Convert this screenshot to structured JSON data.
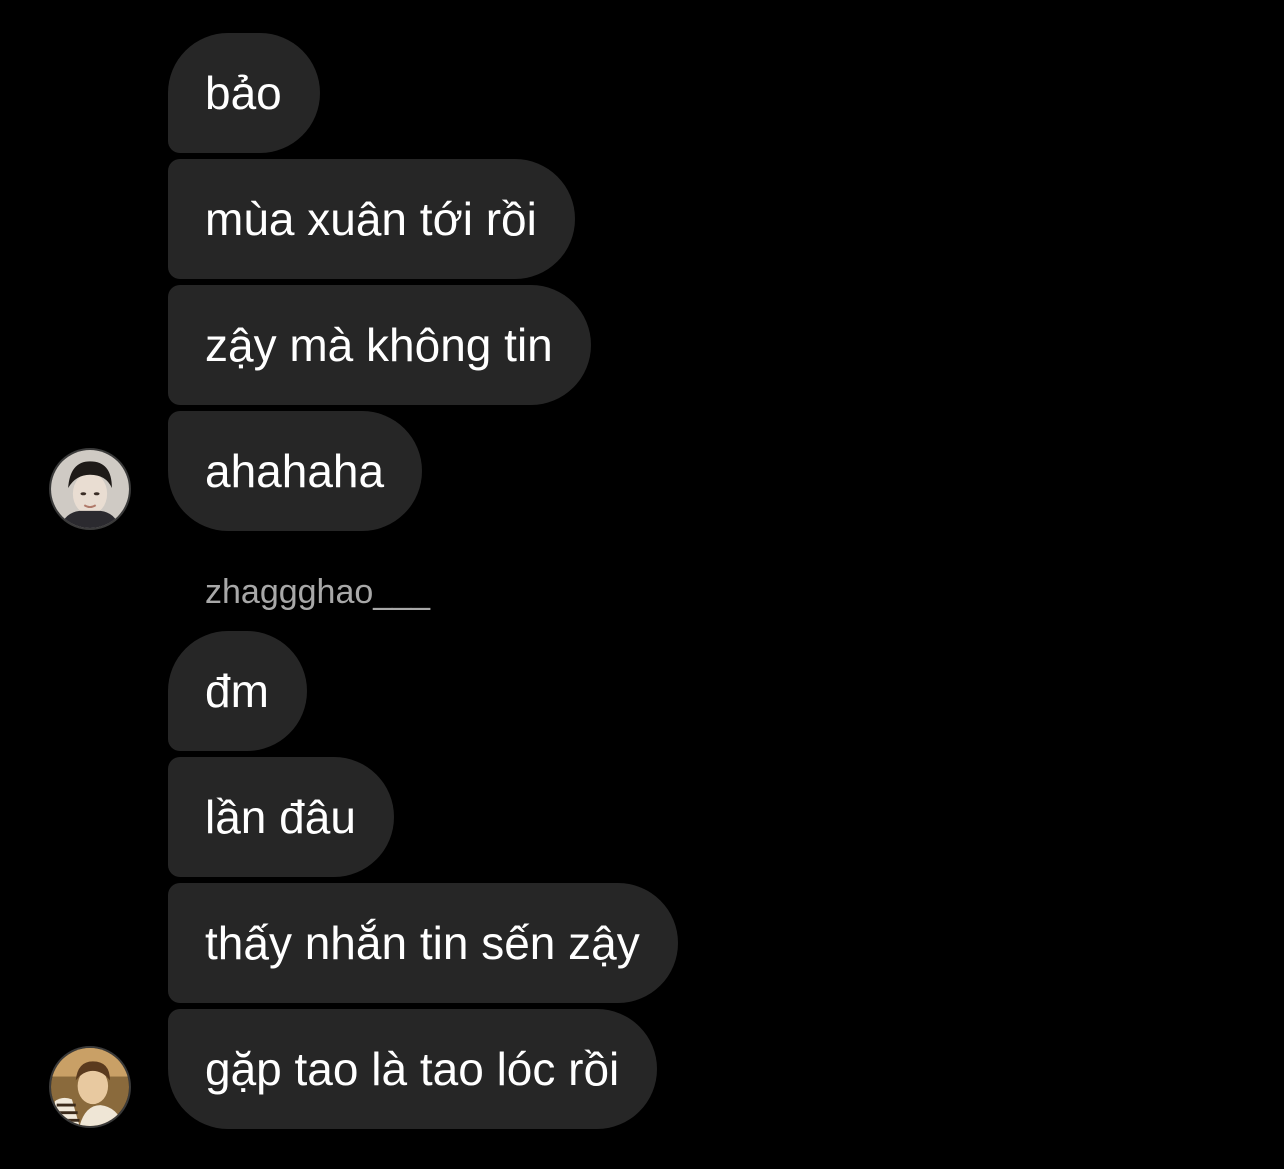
{
  "conversation": {
    "group_1": {
      "messages": [
        "bảo",
        "mùa xuân tới rồi",
        "zậy mà không tin",
        "ahahaha"
      ],
      "avatar_icon": "user-avatar-photo"
    },
    "group_2": {
      "sender_name": "zhaggghao___",
      "messages": [
        "đm",
        "lần đâu",
        "thấy nhắn tin sến zậy",
        "gặp tao là tao lóc rồi"
      ],
      "avatar_icon": "user-avatar-photo"
    }
  },
  "colors": {
    "background": "#000000",
    "bubble": "#262626",
    "text": "#ffffff",
    "sender_name": "#a8a8a8"
  }
}
